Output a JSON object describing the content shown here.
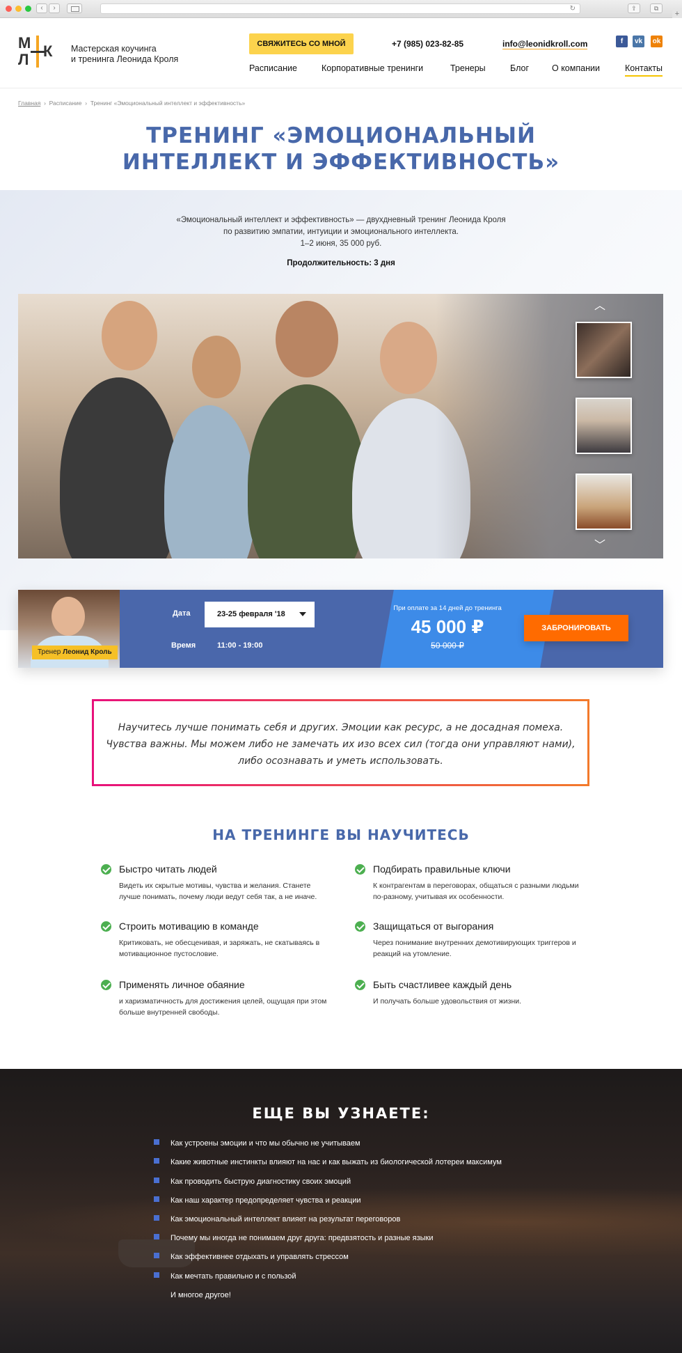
{
  "header": {
    "tagline_line1": "Мастерская коучинга",
    "tagline_line2": "и тренинга Леонида Кроля",
    "cta_label": "СВЯЖИТЕСЬ СО МНОЙ",
    "phone": "+7 (985) 023-82-85",
    "email": "info@leonidkroll.com",
    "logo_letters": [
      "М",
      "Л",
      "К"
    ],
    "menu": [
      "Расписание",
      "Корпоративные тренинги",
      "Тренеры",
      "Блог",
      "О компании",
      "Контакты"
    ]
  },
  "breadcrumb": [
    "Главная",
    "Расписание",
    "Тренинг «Эмоциональный интеллект и эффективность»"
  ],
  "page": {
    "title_line1": "ТРЕНИНГ «ЭМОЦИОНАЛЬНЫЙ",
    "title_line2": "ИНТЕЛЛЕКТ И ЭФФЕКТИВНОСТЬ»",
    "intro_line1": "«Эмоциональный интеллект и эффективность» — двухдневный тренинг Леонида Кроля",
    "intro_line2": "по развитию эмпатии, интуиции и эмоционального интеллекта.",
    "intro_line3": "1–2 июня, 35 000 руб.",
    "duration": "Продолжительность: 3 дня"
  },
  "booking": {
    "trainer_prefix": "Тренер",
    "trainer_name": "Леонид Кроль",
    "date_label": "Дата",
    "date_value": "23-25 февраля '18",
    "time_label": "Время",
    "time_value": "11:00 - 19:00",
    "price_note": "При оплате за 14 дней до тренинга",
    "price": "45 000 ₽",
    "old_price": "50 000 ₽",
    "book_label": "ЗАБРОНИРОВАТЬ"
  },
  "quote": {
    "line1": "Научитесь лучше понимать себя и других. Эмоции как ресурс, а не досадная помеха.",
    "line2": "Чувства важны. Мы можем либо не замечать их изо всех сил (тогда они управляют нами),",
    "line3": "либо осознавать и уметь использовать."
  },
  "skills": {
    "title": "НА ТРЕНИНГЕ ВЫ НАУЧИТЕСЬ",
    "items": [
      {
        "title": "Быстро читать людей",
        "desc": "Видеть их скрытые мотивы, чувства и желания. Станете лучше понимать, почему люди ведут себя так, а не иначе."
      },
      {
        "title": "Подбирать правильные ключи",
        "desc": "К контрагентам в переговорах, общаться с разными людьми по-разному, учитывая их особенности."
      },
      {
        "title": "Строить мотивацию в команде",
        "desc": "Критиковать, не обесценивая, и заряжать, не скатываясь в мотивационное пустословие."
      },
      {
        "title": "Защищаться от выгорания",
        "desc": "Через понимание внутренних демотивирующих триггеров и реакций на утомление."
      },
      {
        "title": "Применять личное обаяние",
        "desc": "и харизматичность для достижения целей, ощущая при этом больше внутренней свободы."
      },
      {
        "title": "Быть счастливее каждый день",
        "desc": "И получать больше удовольствия от жизни."
      }
    ]
  },
  "learn_more": {
    "title": "ЕЩЕ ВЫ УЗНАЕТЕ:",
    "items": [
      "Как устроены эмоции и что мы обычно не учитываем",
      "Какие животные инстинкты влияют на нас и как выжать из биологической лотереи максимум",
      "Как проводить быструю диагностику своих эмоций",
      "Как наш характер предопределяет чувства и реакции",
      "Как эмоциональный интеллект влияет на результат переговоров",
      "Почему мы иногда не понимаем друг друга: предвзятость и разные языки",
      "Как эффективнее отдыхать и управлять стрессом",
      "Как мечтать правильно и с пользой"
    ],
    "footer": "И многое другое!"
  }
}
